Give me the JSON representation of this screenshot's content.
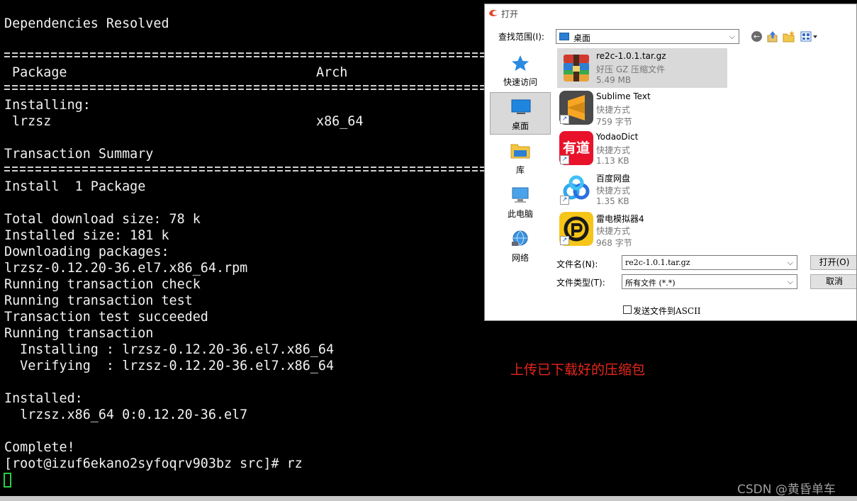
{
  "terminal": {
    "lines": {
      "deps_resolved": "Dependencies Resolved",
      "col_package": "Package",
      "col_arch": "Arch",
      "installing_header": "Installing:",
      "pkg_name": "lrzsz",
      "pkg_arch": "x86_64",
      "txn_summary": "Transaction Summary",
      "install_count": "Install  1 Package",
      "total_download": "Total download size: 78 k",
      "installed_size": "Installed size: 181 k",
      "downloading": "Downloading packages:",
      "rpm_file": "lrzsz-0.12.20-36.el7.x86_64.rpm",
      "txn_check": "Running transaction check",
      "txn_test": "Running transaction test",
      "txn_test_ok": "Transaction test succeeded",
      "running_txn": "Running transaction",
      "installing_line": "  Installing : lrzsz-0.12.20-36.el7.x86_64",
      "verifying_line": "  Verifying  : lrzsz-0.12.20-36.el7.x86_64",
      "installed_header": "Installed:",
      "installed_pkg": "  lrzsz.x86_64 0:0.12.20-36.el7",
      "complete": "Complete!",
      "prompt": "[root@izuf6ekano2syfoqrv903bz src]# rz"
    }
  },
  "annotation": {
    "note": "上传已下载好的压缩包",
    "watermark": "CSDN @黄昏单车"
  },
  "dialog": {
    "title": "打开",
    "lookin_label": "查找范围(I):",
    "lookin_value": "桌面",
    "places": [
      {
        "label": "快速访问",
        "icon": "star-icon"
      },
      {
        "label": "桌面",
        "icon": "desktop-icon",
        "selected": true
      },
      {
        "label": "库",
        "icon": "library-folder-icon"
      },
      {
        "label": "此电脑",
        "icon": "computer-icon"
      },
      {
        "label": "网络",
        "icon": "network-icon"
      }
    ],
    "files": [
      {
        "name": "re2c-1.0.1.tar.gz",
        "type": "好压 GZ 压缩文件",
        "size": "5.49 MB",
        "icon": "archive-icon",
        "selected": true
      },
      {
        "name": "Sublime Text",
        "type": "快捷方式",
        "size": "759 字节",
        "icon": "sublime-icon"
      },
      {
        "name": "YodaoDict",
        "type": "快捷方式",
        "size": "1.13 KB",
        "icon": "youdao-icon",
        "icon_text": "有道"
      },
      {
        "name": "百度网盘",
        "type": "快捷方式",
        "size": "1.35 KB",
        "icon": "baidu-netdisk-icon"
      },
      {
        "name": "雷电模拟器4",
        "type": "快捷方式",
        "size": "968 字节",
        "icon": "ldplayer-icon"
      }
    ],
    "filename_label": "文件名(N):",
    "filename_value": "re2c-1.0.1.tar.gz",
    "filetype_label": "文件类型(T):",
    "filetype_value": "所有文件 (*.*)",
    "open_button": "打开(O)",
    "cancel_button": "取消",
    "ascii_label": "发送文件到ASCII",
    "ascii_checked": false
  },
  "colors": {
    "terminal_bg": "#000000",
    "terminal_text": "#f2f2f2",
    "cursor": "#2ecc40",
    "note": "#e8261c",
    "selection": "#d9d9d9"
  }
}
